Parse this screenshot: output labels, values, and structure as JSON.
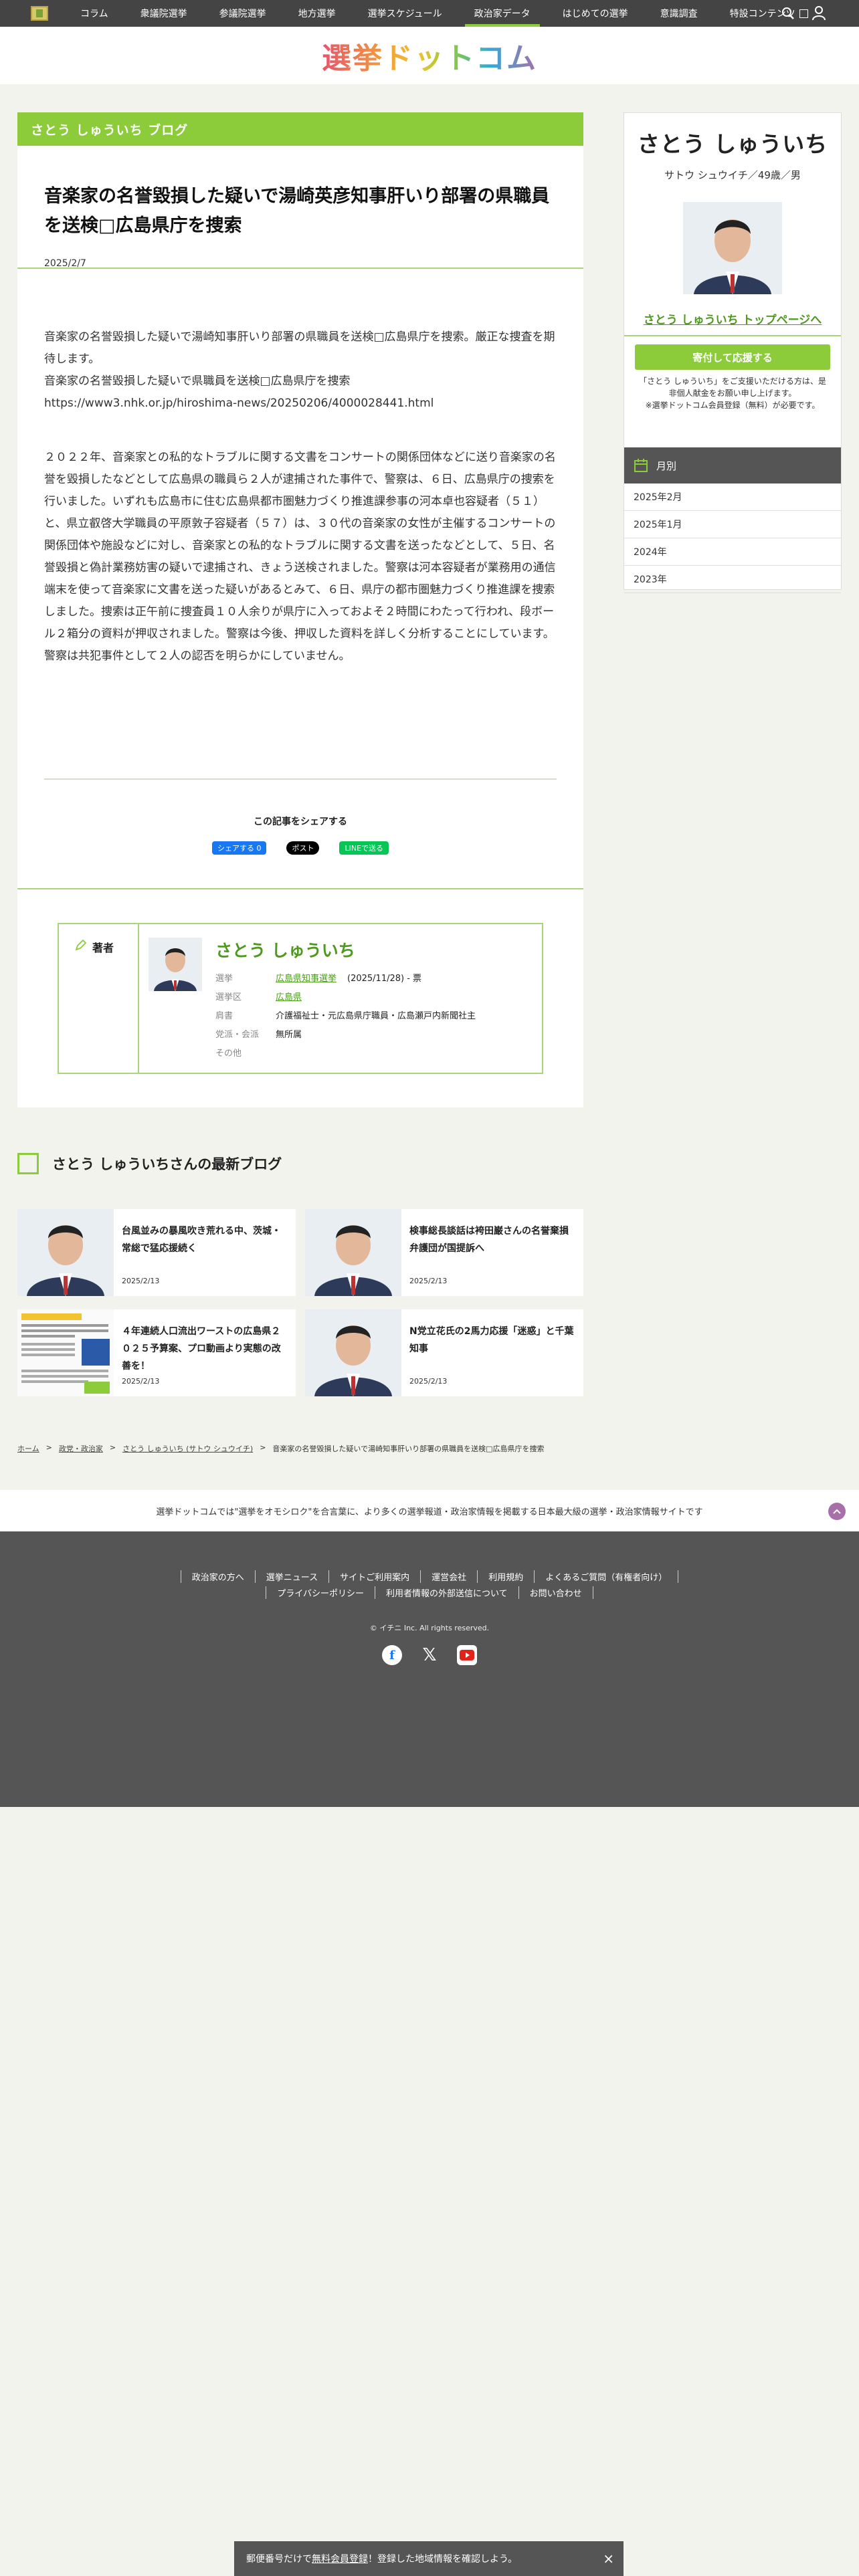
{
  "nav": {
    "items": [
      "コラム",
      "衆議院選挙",
      "参議院選挙",
      "地方選挙",
      "選挙スケジュール",
      "政治家データ",
      "はじめての選挙",
      "意識調査",
      "特設コンテンツ"
    ],
    "active": "政治家データ"
  },
  "site": {
    "logo": "選挙ドットコム"
  },
  "article": {
    "blog_label": "さとう しゅういち ブログ",
    "title": "音楽家の名誉毀損した疑いで湯崎英彦知事肝いり部署の県職員を送検□広島県庁を捜索",
    "date": "2025/2/7",
    "paragraph1": [
      "音楽家の名誉毀損した疑いで湯崎知事肝いり部署の県職員を送検□広島県庁を捜索。厳正な捜査を期待します。",
      "音楽家の名誉毀損した疑いで県職員を送検□広島県庁を捜索",
      "https://www3.nhk.or.jp/hiroshima-news/20250206/4000028441.html"
    ],
    "paragraph2": "２０２２年、音楽家との私的なトラブルに関する文書をコンサートの関係団体などに送り音楽家の名誉を毀損したなどとして広島県の職員ら２人が逮捕された事件で、警察は、６日、広島県庁の捜索を行いました。いずれも広島市に住む広島県都市圏魅力づくり推進課参事の河本卓也容疑者（５１）と、県立叡啓大学職員の平原敦子容疑者（５７）は、３０代の音楽家の女性が主催するコンサートの関係団体や施設などに対し、音楽家との私的なトラブルに関する文書を送ったなどとして、５日、名誉毀損と偽計業務妨害の疑いで逮捕され、きょう送検されました。警察は河本容疑者が業務用の通信端末を使って音楽家に文書を送った疑いがあるとみて、６日、県庁の都市圏魅力づくり推進課を捜索しました。捜索は正午前に捜査員１０人余りが県庁に入っておよそ２時間にわたって行われ、段ボール２箱分の資料が押収されました。警察は今後、押収した資料を詳しく分析することにしています。警察は共犯事件として２人の認否を明らかにしていません。",
    "share_title": "この記事をシェアする",
    "share_fb": "シェアする 0",
    "share_x": "ポスト",
    "share_line": "LINEで送る"
  },
  "author": {
    "label": "著者",
    "name": "さとう しゅういち",
    "rows": [
      {
        "k": "選挙",
        "v": "広島県知事選挙",
        "extra": "(2025/11/28) - 票"
      },
      {
        "k": "選挙区",
        "v": "広島県",
        "extra": ""
      },
      {
        "k": "肩書",
        "v": "介護福祉士・元広島県庁職員・広島瀬戸内新聞社主",
        "extra": ""
      },
      {
        "k": "党派・会派",
        "v": "無所属",
        "extra": ""
      },
      {
        "k": "その他",
        "v": "",
        "extra": ""
      }
    ]
  },
  "sidebar": {
    "name": "さとう しゅういち",
    "sub": "サトウ シュウイチ／49歳／男",
    "top_link": "さとう しゅういち トップページへ",
    "donate": "寄付して応援する",
    "note": "「さとう しゅういち」をご支援いただける方は、是非個人献金をお願い申し上げます。\n※選挙ドットコム会員登録（無料）が必要です。",
    "month_header": "月別",
    "months": [
      "2025年2月",
      "2025年1月",
      "2024年",
      "2023年"
    ]
  },
  "latest": {
    "header": "さとう しゅういちさんの最新ブログ",
    "cards": [
      {
        "title": "台風並みの暴風吹き荒れる中、茨城・常総で猛応援続く",
        "date": "2025/2/13"
      },
      {
        "title": "検事総長談話は袴田巌さんの名誉棄損弁護団が国提訴へ",
        "date": "2025/2/13"
      },
      {
        "title": "４年連続人口流出ワーストの広島県２０２５予算案、プロ動画より実態の改善を！",
        "date": "2025/2/13"
      },
      {
        "title": "N党立花氏の2馬力応援「迷惑」と千葉知事",
        "date": "2025/2/13"
      }
    ]
  },
  "breadcrumb": [
    "ホーム",
    "政党・政治家",
    "さとう しゅういち (サトウ シュウイチ)",
    "音楽家の名誉毀損した疑いで湯崎知事肝いり部署の県職員を送検□広島県庁を捜索"
  ],
  "tagline": "選挙ドットコムでは\"選挙をオモシロク\"を合言葉に、より多くの選挙報道・政治家情報を掲載する日本最大級の選挙・政治家情報サイトです",
  "footer": {
    "links1": [
      "政治家の方へ",
      "選挙ニュース",
      "サイトご利用案内",
      "運営会社",
      "利用規約",
      "よくあるご質問（有権者向け）"
    ],
    "links2": [
      "プライバシーポリシー",
      "利用者情報の外部送信について",
      "お問い合わせ"
    ],
    "copyright": "© イチニ Inc. All rights reserved."
  },
  "banner": {
    "pre": "郵便番号だけで",
    "link": "無料会員登録",
    "post": "！登録した地域情報を確認しよう。"
  }
}
